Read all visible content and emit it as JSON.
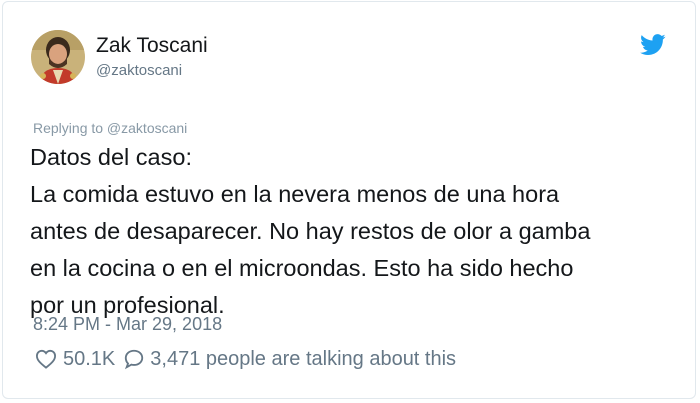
{
  "author": {
    "display_name": "Zak Toscani",
    "handle": "@zaktoscani",
    "avatar_icon": "avatar-photo",
    "platform_icon": "twitter-bird-icon"
  },
  "reply": {
    "replying_to": "Replying to @zaktoscani"
  },
  "tweet": {
    "lines": [
      "Datos del caso:",
      "La comida estuvo en la nevera menos de una hora",
      "antes de desaparecer. No hay restos de olor a gamba",
      "en la cocina o en el microondas. Esto ha sido hecho",
      "por un profesional."
    ],
    "timestamp": "8:24 PM - Mar 29, 2018"
  },
  "engagement": {
    "likes": "50.1K",
    "talking": "3,471 people are talking about this"
  },
  "colors": {
    "text_primary": "#14171a",
    "text_secondary": "#657786",
    "twitter_blue": "#1da1f2",
    "border": "#e1e8ed"
  }
}
